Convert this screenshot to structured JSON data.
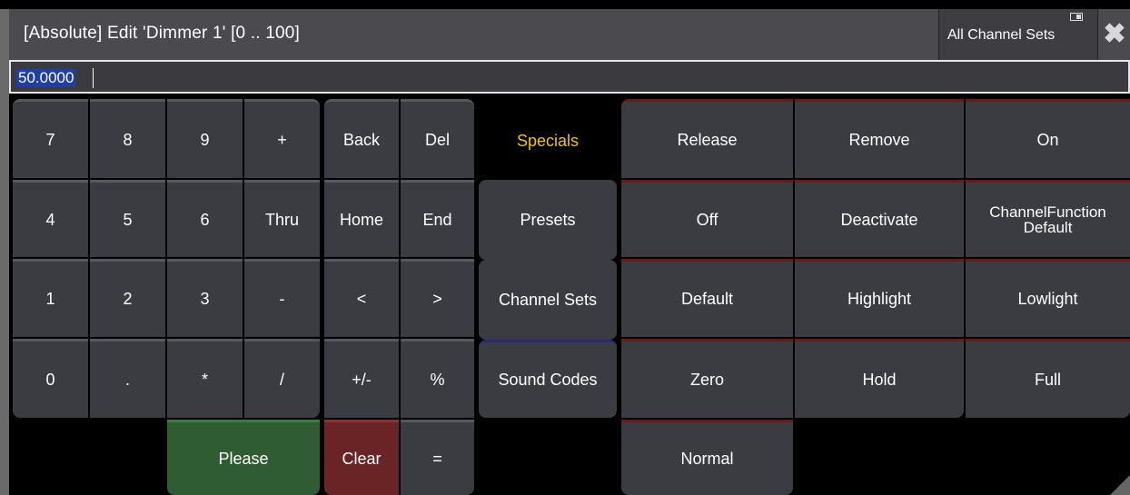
{
  "window": {
    "title": "[Absolute] Edit 'Dimmer 1' [0 .. 100]",
    "channel_sets_button": "All Channel Sets",
    "close_glyph": "✖"
  },
  "input": {
    "value": "50.0000"
  },
  "numpad": {
    "k7": "7",
    "k8": "8",
    "k9": "9",
    "plus": "+",
    "k4": "4",
    "k5": "5",
    "k6": "6",
    "thru": "Thru",
    "k1": "1",
    "k2": "2",
    "k3": "3",
    "minus": "-",
    "k0": "0",
    "dot": ".",
    "star": "*",
    "slash": "/",
    "please": "Please"
  },
  "editkeys": {
    "back": "Back",
    "del": "Del",
    "home": "Home",
    "end": "End",
    "left": "<",
    "right": ">",
    "plusminus": "+/-",
    "percent": "%",
    "clear": "Clear",
    "equals": "="
  },
  "tabs": {
    "specials": "Specials",
    "presets": "Presets",
    "channel_sets": "Channel Sets",
    "sound_codes": "Sound Codes"
  },
  "functions": {
    "release": "Release",
    "remove": "Remove",
    "on": "On",
    "off": "Off",
    "deactivate": "Deactivate",
    "cf_default_line1": "ChannelFunction",
    "cf_default_line2": "Default",
    "default": "Default",
    "highlight": "Highlight",
    "lowlight": "Lowlight",
    "zero": "Zero",
    "hold": "Hold",
    "full": "Full",
    "normal": "Normal"
  },
  "colors": {
    "accent_yellow": "#f5c400",
    "please_green": "#2f5c32",
    "clear_red": "#6b2426",
    "selection_blue": "#1f3ea8"
  }
}
